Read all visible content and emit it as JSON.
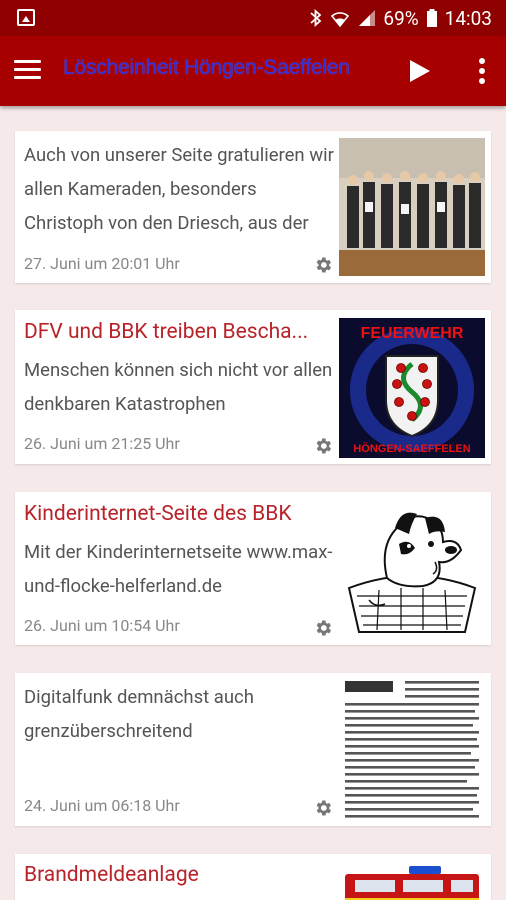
{
  "status_bar": {
    "battery_percent": "69%",
    "time": "14:03",
    "icons": [
      "image-icon",
      "bluetooth-icon",
      "wifi-icon",
      "signal-icon",
      "battery-icon"
    ]
  },
  "app_bar": {
    "title": "Löscheinheit Höngen-Saeffelen",
    "icons": [
      "menu-icon",
      "play-icon",
      "more-vert-icon"
    ]
  },
  "colors": {
    "status_bar": "#8f0000",
    "app_bar": "#a70000",
    "app_title": "#2f2fd8",
    "card_title": "#b8232a",
    "background": "#f6e9e9"
  },
  "articles": [
    {
      "title": "",
      "excerpt": "Auch von unserer Seite gratulieren wir allen Kameraden, besonders Christoph von den Driesch, aus der",
      "date": "27. Juni um 20:01 Uhr",
      "thumbnail": "group-photo-image"
    },
    {
      "title": "DFV und BBK treiben Bescha...",
      "excerpt": "Menschen können sich nicht vor allen denkbaren Katastrophen",
      "date": "26. Juni um 21:25 Uhr",
      "thumbnail": "feuerwehr-emblem-image",
      "thumbnail_text": {
        "top": "FEUERWEHR",
        "bottom": "HÖNGEN-SAEFFELEN"
      }
    },
    {
      "title": "Kinderinternet-Seite des BBK",
      "excerpt": "Mit der Kinderinternetseite www.max-und-flocke-helferland.de",
      "date": "26. Juni um 10:54 Uhr",
      "thumbnail": "cartoon-dog-image"
    },
    {
      "title": "",
      "excerpt": "Digitalfunk demnächst auch grenzüberschreitend",
      "date": "24. Juni um 06:18 Uhr",
      "thumbnail": "newspaper-clipping-image"
    },
    {
      "title": "Brandmeldeanlage",
      "excerpt": "",
      "date": "",
      "thumbnail": "fire-truck-image"
    }
  ]
}
